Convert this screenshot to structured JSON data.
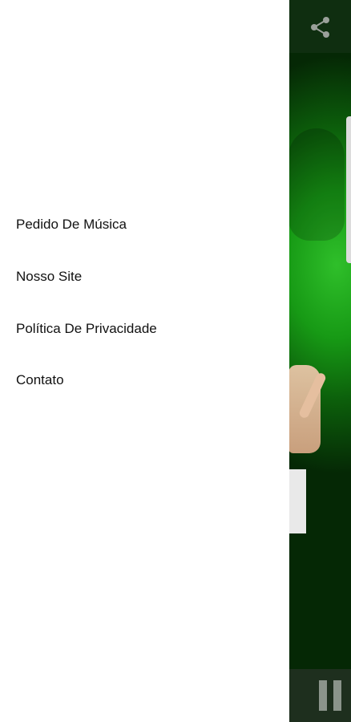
{
  "drawer": {
    "items": [
      {
        "label": "Pedido De Música"
      },
      {
        "label": "Nosso Site"
      },
      {
        "label": "Política De Privacidade"
      },
      {
        "label": "Contato"
      }
    ]
  },
  "toolbar": {
    "share_icon": "share-icon"
  },
  "player": {
    "pause_icon": "pause-icon"
  },
  "colors": {
    "drawer_bg": "#ffffff",
    "accent_green": "#179a15",
    "toolbar_bg": "#0f2e10"
  }
}
